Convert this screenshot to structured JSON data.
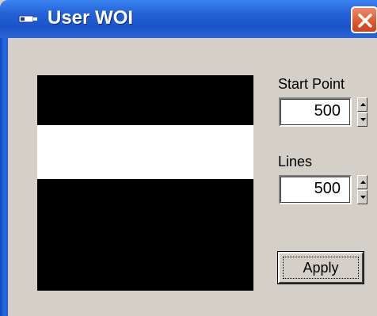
{
  "window": {
    "title": "User WOI",
    "colors": {
      "titlebar": "#2462d8",
      "close": "#e0562a",
      "face": "#d4d0c8"
    }
  },
  "icons": {
    "title": "app-icon",
    "close": "close-icon",
    "up": "arrow-up-icon",
    "down": "arrow-down-icon"
  },
  "controls": {
    "start_point": {
      "label": "Start Point",
      "value": "500"
    },
    "lines": {
      "label": "Lines",
      "value": "500"
    },
    "apply_label": "Apply"
  }
}
